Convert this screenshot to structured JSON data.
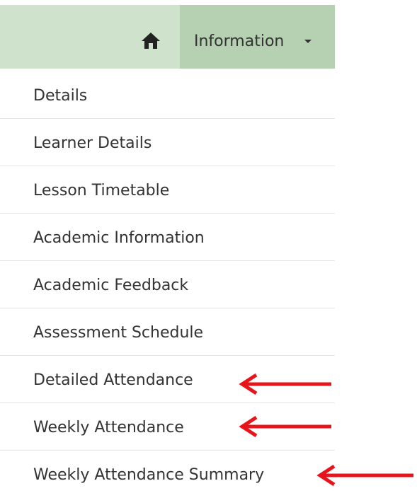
{
  "navbar": {
    "home_icon": "home-icon",
    "dropdown_label": "Information",
    "dropdown_icon": "caret-down-icon",
    "bg_color": "#cfe3cc",
    "active_tab_color": "#b6d0b2"
  },
  "menu": {
    "items": [
      {
        "label": "Details"
      },
      {
        "label": "Learner Details"
      },
      {
        "label": "Lesson Timetable"
      },
      {
        "label": "Academic Information"
      },
      {
        "label": "Academic Feedback"
      },
      {
        "label": "Assessment Schedule"
      },
      {
        "label": "Detailed Attendance"
      },
      {
        "label": "Weekly Attendance"
      },
      {
        "label": "Weekly Attendance Summary"
      }
    ]
  },
  "annotations": {
    "arrow_color": "#e8141b",
    "arrow_icon": "left-arrow-icon"
  }
}
